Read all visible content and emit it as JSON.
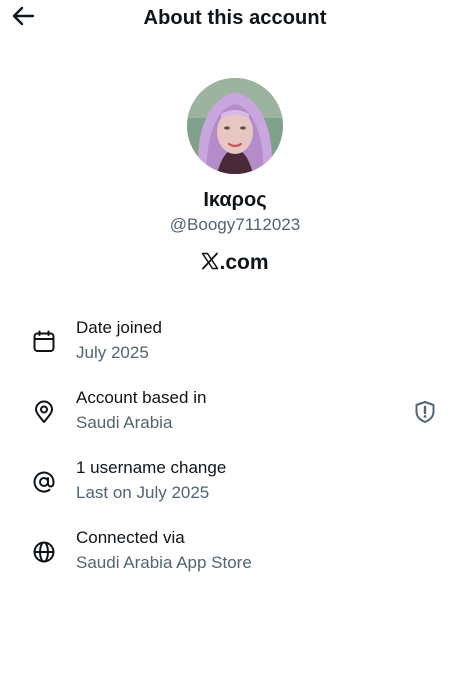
{
  "header": {
    "title": "About this account",
    "back_icon": "arrow-left-icon"
  },
  "profile": {
    "display_name": "Ικαρος",
    "handle": "@Boogy7112023",
    "site": ".com",
    "site_logo_icon": "x-logo-icon",
    "avatar_bg": "#7fa089",
    "hood_color": "#c9a6dd"
  },
  "rows": [
    {
      "icon": "calendar-icon",
      "title": "Date joined",
      "value": "July 2025"
    },
    {
      "icon": "location-pin-icon",
      "title": "Account based in",
      "value": "Saudi Arabia",
      "trailing_icon": "shield-alert-icon"
    },
    {
      "icon": "at-sign-icon",
      "title": "1 username change",
      "value": "Last on July 2025"
    },
    {
      "icon": "globe-icon",
      "title": "Connected via",
      "value": "Saudi Arabia App Store"
    }
  ],
  "colors": {
    "primary_text": "#0f1419",
    "secondary_text": "#536471"
  }
}
